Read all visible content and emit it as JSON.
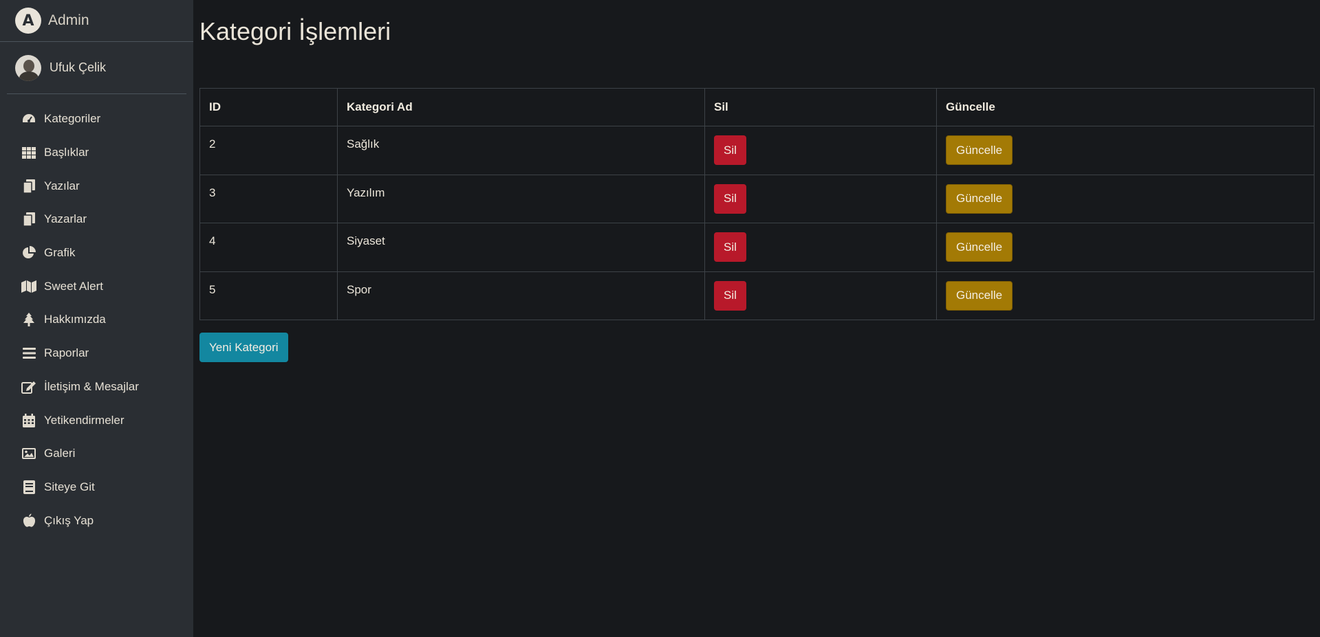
{
  "brand": {
    "title": "Admin",
    "logo_letter": "A"
  },
  "user": {
    "name": "Ufuk Çelik"
  },
  "sidebar": {
    "items": [
      {
        "label": "Kategoriler",
        "icon": "tachometer-icon"
      },
      {
        "label": "Başlıklar",
        "icon": "grid-icon"
      },
      {
        "label": "Yazılar",
        "icon": "copy-icon"
      },
      {
        "label": "Yazarlar",
        "icon": "copy-icon"
      },
      {
        "label": "Grafik",
        "icon": "chart-pie-icon"
      },
      {
        "label": "Sweet Alert",
        "icon": "map-icon"
      },
      {
        "label": "Hakkımızda",
        "icon": "tree-icon"
      },
      {
        "label": "Raporlar",
        "icon": "bars-icon"
      },
      {
        "label": "İletişim & Mesajlar",
        "icon": "edit-icon"
      },
      {
        "label": "Yetikendirmeler",
        "icon": "calendar-icon"
      },
      {
        "label": "Galeri",
        "icon": "image-icon"
      },
      {
        "label": "Siteye Git",
        "icon": "book-icon"
      },
      {
        "label": "Çıkış Yap",
        "icon": "apple-icon"
      }
    ]
  },
  "page": {
    "title": "Kategori İşlemleri"
  },
  "table": {
    "headers": [
      "ID",
      "Kategori Ad",
      "Sil",
      "Güncelle"
    ],
    "rows": [
      {
        "id": "2",
        "name": "Sağlık",
        "delete_label": "Sil",
        "update_label": "Güncelle"
      },
      {
        "id": "3",
        "name": "Yazılım",
        "delete_label": "Sil",
        "update_label": "Güncelle"
      },
      {
        "id": "4",
        "name": "Siyaset",
        "delete_label": "Sil",
        "update_label": "Güncelle"
      },
      {
        "id": "5",
        "name": "Spor",
        "delete_label": "Sil",
        "update_label": "Güncelle"
      }
    ]
  },
  "actions": {
    "new_category_label": "Yeni Kategori"
  },
  "colors": {
    "danger": "#b8192a",
    "warning": "#a37a05",
    "info": "#1387a0",
    "sidebar_bg": "#2a2e33",
    "page_bg": "#17191c"
  }
}
